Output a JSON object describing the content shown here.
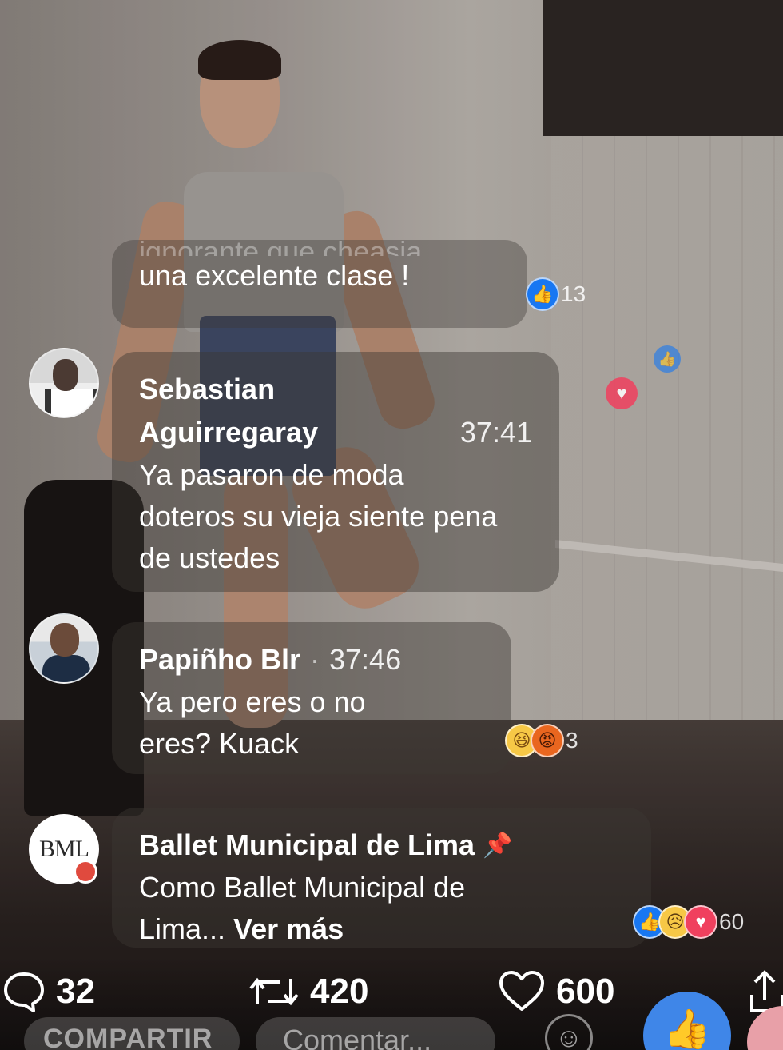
{
  "comments": {
    "partial": {
      "clipped_text": "ignorante que cheasia",
      "text": "una excelente clase !",
      "like_count": "13"
    },
    "sebastian": {
      "name_line1": "Sebastian",
      "name_line2": "Aguirregaray",
      "time": "37:41",
      "text_line1": "Ya pasaron de moda",
      "text_line2": "doteros su vieja siente pena",
      "text_line3": "de ustedes"
    },
    "papinho": {
      "name": "Papiñho Blr",
      "separator": "·",
      "time": "37:46",
      "text_line1": "Ya pero eres o no",
      "text_line2": "eres? Kuack",
      "reaction_count": "3"
    },
    "ballet": {
      "avatar_text": "BML",
      "name": "Ballet Municipal de Lima",
      "text_line1": "Como Ballet Municipal de",
      "text_line2": "Lima...",
      "see_more": "Ver más",
      "reaction_count": "60"
    }
  },
  "stats": {
    "comments": "32",
    "retweets": "420",
    "likes": "600"
  },
  "bottom_bar": {
    "share_label": "COMPARTIR",
    "comment_placeholder": "Comentar..."
  },
  "icons": {
    "like": "like-icon",
    "haha": "haha-icon",
    "angry": "angry-icon",
    "sad": "sad-icon",
    "love": "love-icon",
    "pin": "pin-icon",
    "comment": "comment-bubble-icon",
    "retweet": "retweet-icon",
    "heart": "heart-icon",
    "share": "share-icon"
  },
  "colors": {
    "facebook_blue": "#1877f2",
    "love_red": "#f0405e",
    "bubble_bg": "rgba(60,55,52,0.45)"
  }
}
